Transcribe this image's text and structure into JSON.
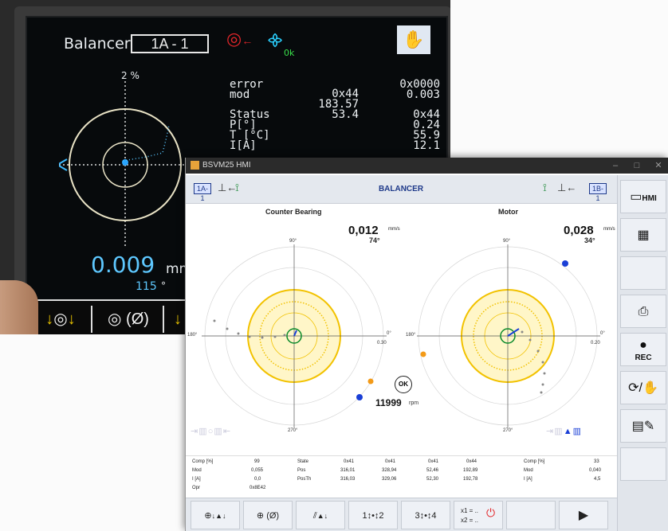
{
  "device": {
    "title": "Balancer",
    "machine": "1A - 1",
    "ok_badge": "0k",
    "scale": "2 %",
    "readouts": {
      "labels": [
        "error",
        "mod",
        "Status",
        "P[°]",
        "T [°C]",
        "I[A]"
      ],
      "col1": [
        "",
        "",
        "0x44",
        "183.57",
        "53.4",
        ""
      ],
      "col2": [
        "0x0000",
        "0.003",
        "0x44",
        "0.24",
        "55.9",
        "12.1"
      ]
    },
    "amplitude": "0.009",
    "amplitude_unit": "mm",
    "angle": "115",
    "angle_unit": "°"
  },
  "window": {
    "title": "BSVM25 HMI",
    "chip_left": "1A-1",
    "chip_right": "1B-1",
    "header": "BALANCER"
  },
  "plots": [
    {
      "title": "Counter Bearing",
      "amplitude": "0,012",
      "unit": "mm/s",
      "angle": "74°",
      "labels": {
        "top": "90°",
        "left": "180°",
        "right": "0°",
        "bottom": "270°",
        "scale": "0.30"
      }
    },
    {
      "title": "Motor",
      "amplitude": "0,028",
      "unit": "mm/s",
      "angle": "34°",
      "labels": {
        "top": "90°",
        "left": "180°",
        "right": "0°",
        "bottom": "270°",
        "scale": "0.20"
      }
    }
  ],
  "status": {
    "ok": "OK",
    "rpm": "11999",
    "rpm_unit": "rpm"
  },
  "table": {
    "left": [
      {
        "label": "Comp [%]",
        "value": "99"
      },
      {
        "label": "Mod",
        "value": "0,055"
      },
      {
        "label": "I [A]",
        "value": "0,0"
      },
      {
        "label": "Opr",
        "value": "0x8E42"
      }
    ],
    "mid_labels": [
      "State",
      "Pos",
      "PosTh"
    ],
    "mid_values": [
      [
        "0x41",
        "0x41",
        "0x41",
        "0x44"
      ],
      [
        "316,01",
        "328,94",
        "52,46",
        "192,89"
      ],
      [
        "316,03",
        "329,06",
        "52,30",
        "192,78"
      ]
    ],
    "right": [
      {
        "label": "Comp [%]",
        "value": "33"
      },
      {
        "label": "Mod",
        "value": "0,040"
      },
      {
        "label": "I [A]",
        "value": "4,5"
      }
    ]
  },
  "right_bar": {
    "hmi_label": "HMI",
    "rec_label": "REC"
  },
  "bottom_bar": {
    "btn4": "1↕•↕2",
    "btn5": "3↕•↕4",
    "btn6_line1": "x1 = ..",
    "btn6_line2": "x2 = .."
  },
  "colors": {
    "ring_yellow": "#f2c200",
    "ring_green": "#0a8a2a",
    "marker_blue": "#1a3fd6",
    "marker_orange": "#f39a17",
    "accent": "#1f3a8a"
  }
}
